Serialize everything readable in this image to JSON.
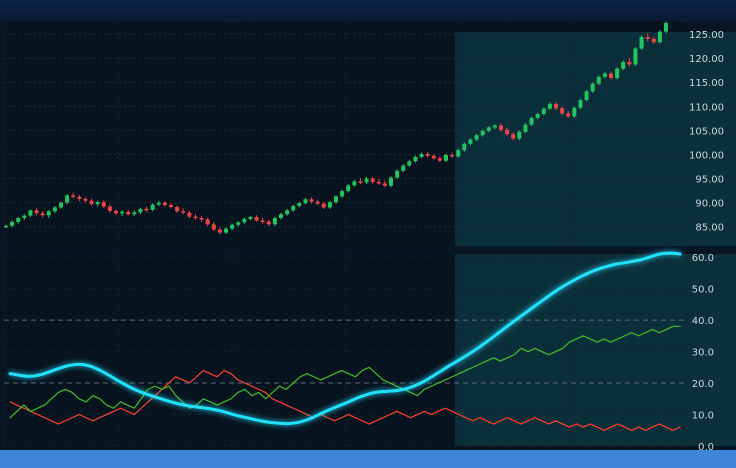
{
  "chart_data": [
    {
      "type": "candlestick",
      "title": "",
      "xlabel": "",
      "ylabel": "",
      "y_ticks": [
        "85.00",
        "90.00",
        "95.00",
        "100.00",
        "105.00",
        "110.00",
        "115.00",
        "120.00",
        "125.00"
      ],
      "ylim": [
        81.0,
        127.5
      ],
      "grid": true,
      "up_color": "#22c55e",
      "down_color": "#ef4444",
      "highlight_start_index": 74,
      "highlight_end_index": 121,
      "candles": [
        [
          85.0,
          85.4,
          84.7,
          85.2
        ],
        [
          85.2,
          86.3,
          84.9,
          86.0
        ],
        [
          86.0,
          87.0,
          85.6,
          86.8
        ],
        [
          86.8,
          87.6,
          86.4,
          87.3
        ],
        [
          87.3,
          88.6,
          87.0,
          88.4
        ],
        [
          88.4,
          88.9,
          87.4,
          87.8
        ],
        [
          87.8,
          88.2,
          86.9,
          87.4
        ],
        [
          87.4,
          88.5,
          86.8,
          88.2
        ],
        [
          88.2,
          89.3,
          87.8,
          89.0
        ],
        [
          89.0,
          90.2,
          88.7,
          90.0
        ],
        [
          90.0,
          91.8,
          89.7,
          91.5
        ],
        [
          91.5,
          92.1,
          90.9,
          91.2
        ],
        [
          91.2,
          91.6,
          90.3,
          90.8
        ],
        [
          90.8,
          91.1,
          90.0,
          90.4
        ],
        [
          90.4,
          90.8,
          89.4,
          89.7
        ],
        [
          89.7,
          90.4,
          89.2,
          90.1
        ],
        [
          90.1,
          90.5,
          88.9,
          89.2
        ],
        [
          89.2,
          89.6,
          87.9,
          88.3
        ],
        [
          88.3,
          88.6,
          87.4,
          87.8
        ],
        [
          87.8,
          88.4,
          87.2,
          88.1
        ],
        [
          88.1,
          88.5,
          87.3,
          87.6
        ],
        [
          87.6,
          88.4,
          87.2,
          88.0
        ],
        [
          88.0,
          88.9,
          87.6,
          88.7
        ],
        [
          88.7,
          89.2,
          88.1,
          88.5
        ],
        [
          88.5,
          89.9,
          88.2,
          89.6
        ],
        [
          89.6,
          90.4,
          89.3,
          90.0
        ],
        [
          90.0,
          90.3,
          89.2,
          89.5
        ],
        [
          89.5,
          89.9,
          88.8,
          89.1
        ],
        [
          89.1,
          89.4,
          87.9,
          88.2
        ],
        [
          88.2,
          88.8,
          87.6,
          87.9
        ],
        [
          87.9,
          88.3,
          86.8,
          87.1
        ],
        [
          87.1,
          87.6,
          86.4,
          86.8
        ],
        [
          86.8,
          87.3,
          86.0,
          86.5
        ],
        [
          86.5,
          86.9,
          85.1,
          85.5
        ],
        [
          85.5,
          86.0,
          84.1,
          84.4
        ],
        [
          84.4,
          84.8,
          83.4,
          83.8
        ],
        [
          83.8,
          84.9,
          83.5,
          84.6
        ],
        [
          84.6,
          85.7,
          84.3,
          85.4
        ],
        [
          85.4,
          86.2,
          85.0,
          85.9
        ],
        [
          85.9,
          86.9,
          85.6,
          86.6
        ],
        [
          86.6,
          87.3,
          86.3,
          87.0
        ],
        [
          87.0,
          87.4,
          86.0,
          86.3
        ],
        [
          86.3,
          86.8,
          85.6,
          86.1
        ],
        [
          86.1,
          86.5,
          85.2,
          85.5
        ],
        [
          85.5,
          87.1,
          85.2,
          86.8
        ],
        [
          86.8,
          87.9,
          86.5,
          87.6
        ],
        [
          87.6,
          88.7,
          87.3,
          88.4
        ],
        [
          88.4,
          89.6,
          88.1,
          89.3
        ],
        [
          89.3,
          90.2,
          89.0,
          89.9
        ],
        [
          89.9,
          91.0,
          89.6,
          90.7
        ],
        [
          90.7,
          91.1,
          89.8,
          90.2
        ],
        [
          90.2,
          90.6,
          89.5,
          89.8
        ],
        [
          89.8,
          90.1,
          88.7,
          89.0
        ],
        [
          89.0,
          90.4,
          88.7,
          90.1
        ],
        [
          90.1,
          91.6,
          89.8,
          91.3
        ],
        [
          91.3,
          92.7,
          91.0,
          92.4
        ],
        [
          92.4,
          93.9,
          92.1,
          93.6
        ],
        [
          93.6,
          94.7,
          93.3,
          94.4
        ],
        [
          94.4,
          95.1,
          93.8,
          94.2
        ],
        [
          94.2,
          95.3,
          93.9,
          95.0
        ],
        [
          95.0,
          95.4,
          93.9,
          94.3
        ],
        [
          94.3,
          94.9,
          93.7,
          94.0
        ],
        [
          94.0,
          94.6,
          93.2,
          93.5
        ],
        [
          93.5,
          95.5,
          93.2,
          95.2
        ],
        [
          95.2,
          96.9,
          94.9,
          96.6
        ],
        [
          96.6,
          98.0,
          96.3,
          97.7
        ],
        [
          97.7,
          98.9,
          97.4,
          98.6
        ],
        [
          98.6,
          99.8,
          98.3,
          99.5
        ],
        [
          99.5,
          100.4,
          99.2,
          100.1
        ],
        [
          100.1,
          100.5,
          99.4,
          99.7
        ],
        [
          99.7,
          100.1,
          98.9,
          99.2
        ],
        [
          99.2,
          99.6,
          98.4,
          98.7
        ],
        [
          98.7,
          100.2,
          98.4,
          99.9
        ],
        [
          99.9,
          100.4,
          99.3,
          99.6
        ],
        [
          99.6,
          101.2,
          99.3,
          100.9
        ],
        [
          100.9,
          102.5,
          100.6,
          102.2
        ],
        [
          102.2,
          103.4,
          101.9,
          103.1
        ],
        [
          103.1,
          104.3,
          102.8,
          104.0
        ],
        [
          104.0,
          105.2,
          103.7,
          104.9
        ],
        [
          104.9,
          105.9,
          104.6,
          105.6
        ],
        [
          105.6,
          106.3,
          105.3,
          106.0
        ],
        [
          106.0,
          106.4,
          104.8,
          105.1
        ],
        [
          105.1,
          105.5,
          103.9,
          104.2
        ],
        [
          104.2,
          104.6,
          102.9,
          103.3
        ],
        [
          103.3,
          105.0,
          103.0,
          104.7
        ],
        [
          104.7,
          106.5,
          104.4,
          106.2
        ],
        [
          106.2,
          107.9,
          105.9,
          107.6
        ],
        [
          107.6,
          108.7,
          107.3,
          108.4
        ],
        [
          108.4,
          109.8,
          108.1,
          109.5
        ],
        [
          109.5,
          110.8,
          109.2,
          110.5
        ],
        [
          110.5,
          110.9,
          109.2,
          109.6
        ],
        [
          109.6,
          110.0,
          108.1,
          108.5
        ],
        [
          108.5,
          109.0,
          107.6,
          107.9
        ],
        [
          107.9,
          110.0,
          107.6,
          109.7
        ],
        [
          109.7,
          111.6,
          109.4,
          111.3
        ],
        [
          111.3,
          113.4,
          111.0,
          113.1
        ],
        [
          113.1,
          115.0,
          112.8,
          114.7
        ],
        [
          114.7,
          116.4,
          114.4,
          116.1
        ],
        [
          116.1,
          117.1,
          115.8,
          116.8
        ],
        [
          116.8,
          117.2,
          115.5,
          115.9
        ],
        [
          115.9,
          118.1,
          115.6,
          117.8
        ],
        [
          117.8,
          119.5,
          117.5,
          119.2
        ],
        [
          119.2,
          120.0,
          118.3,
          118.7
        ],
        [
          118.7,
          122.3,
          118.4,
          122.0
        ],
        [
          122.0,
          124.7,
          121.7,
          124.4
        ],
        [
          124.4,
          125.1,
          123.5,
          124.0
        ],
        [
          124.0,
          124.4,
          123.0,
          123.3
        ],
        [
          123.3,
          125.8,
          123.0,
          125.5
        ],
        [
          125.5,
          127.6,
          125.2,
          127.3
        ]
      ]
    },
    {
      "type": "line",
      "title": "",
      "xlabel": "",
      "ylabel": "",
      "y_ticks": [
        "0.0",
        "10.0",
        "20.0",
        "30.0",
        "40.0",
        "50.0",
        "60.0"
      ],
      "ylim": [
        0,
        61
      ],
      "grid": true,
      "dashed_levels": [
        20,
        40
      ],
      "series": [
        {
          "color": "#22e1ff",
          "values": [
            23.0,
            22.6,
            22.2,
            22.1,
            22.4,
            23.0,
            23.8,
            24.6,
            25.3,
            25.8,
            26.0,
            25.8,
            25.1,
            24.1,
            22.9,
            21.6,
            20.3,
            19.1,
            18.0,
            17.1,
            16.3,
            15.6,
            14.9,
            14.2,
            13.6,
            13.1,
            12.7,
            12.4,
            12.1,
            11.8,
            11.4,
            10.9,
            10.2,
            9.6,
            9.1,
            8.6,
            8.1,
            7.7,
            7.4,
            7.2,
            7.1,
            7.2,
            7.6,
            8.3,
            9.2,
            10.3,
            11.3,
            12.2,
            13.1,
            14.0,
            15.0,
            15.9,
            16.6,
            17.1,
            17.3,
            17.4,
            17.6,
            18.0,
            18.6,
            19.5,
            20.6,
            21.9,
            23.3,
            24.7,
            26.0,
            27.3,
            28.6,
            30.0,
            31.5,
            33.1,
            34.7,
            36.4,
            38.1,
            39.7,
            41.3,
            42.9,
            44.5,
            46.1,
            47.7,
            49.2,
            50.6,
            51.9,
            53.1,
            54.2,
            55.2,
            56.1,
            56.8,
            57.4,
            57.9,
            58.2,
            58.6,
            59.0,
            59.6,
            60.3,
            61.0,
            61.3,
            61.3,
            61.0
          ]
        },
        {
          "color": "#3fb52a",
          "values": [
            9,
            11,
            13,
            11,
            12,
            13,
            15,
            17,
            18,
            17,
            15,
            14,
            16,
            15,
            13,
            12,
            14,
            13,
            12,
            15,
            18,
            19,
            18,
            19,
            16,
            14,
            12,
            13,
            15,
            14,
            13,
            14,
            15,
            17,
            18,
            16,
            17,
            15,
            17,
            19,
            18,
            20,
            22,
            23,
            22,
            21,
            22,
            23,
            24,
            23,
            22,
            24,
            25,
            23,
            21,
            20,
            19,
            18,
            17,
            16,
            18,
            19,
            20,
            21,
            22,
            23,
            24,
            25,
            26,
            27,
            28,
            27,
            28,
            29,
            31,
            30,
            31,
            30,
            29,
            30,
            31,
            33,
            34,
            35,
            34,
            33,
            34,
            33,
            34,
            35,
            36,
            35,
            36,
            37,
            36,
            37,
            38,
            38
          ]
        },
        {
          "color": "#ef3f2f",
          "values": [
            14,
            13,
            12,
            11,
            10,
            9,
            8,
            7,
            8,
            9,
            10,
            9,
            8,
            9,
            10,
            11,
            12,
            11,
            10,
            12,
            14,
            16,
            18,
            20,
            22,
            21,
            20,
            22,
            24,
            23,
            22,
            24,
            23,
            21,
            20,
            19,
            18,
            17,
            15,
            14,
            13,
            12,
            11,
            10,
            9,
            10,
            9,
            8,
            9,
            10,
            9,
            8,
            7,
            8,
            9,
            10,
            11,
            10,
            9,
            10,
            11,
            10,
            11,
            12,
            11,
            10,
            9,
            8,
            9,
            8,
            7,
            8,
            9,
            8,
            7,
            8,
            9,
            8,
            7,
            8,
            7,
            6,
            7,
            6,
            7,
            6,
            5,
            6,
            7,
            6,
            5,
            6,
            5,
            6,
            7,
            6,
            5,
            6
          ]
        }
      ]
    }
  ]
}
